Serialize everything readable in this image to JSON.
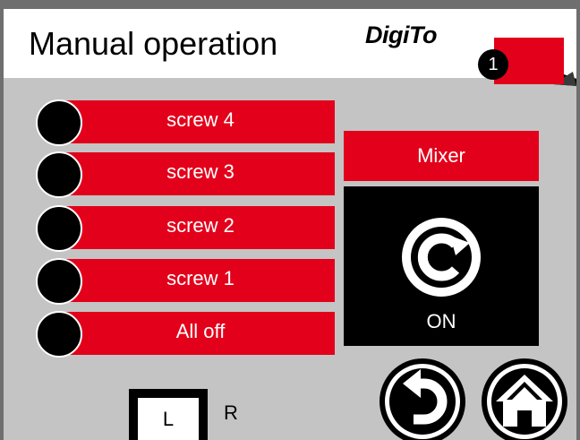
{
  "header": {
    "title": "Manual operation",
    "logo_text": "DigiTo",
    "alarm_count": "1"
  },
  "screws": [
    {
      "label": "screw 4"
    },
    {
      "label": "screw 3"
    },
    {
      "label": "screw 2"
    },
    {
      "label": "screw 1"
    },
    {
      "label": "All off"
    }
  ],
  "mixer": {
    "label": "Mixer",
    "state": "ON",
    "icon": "rotate-clockwise-icon"
  },
  "nav": {
    "back_icon": "back-arrow-icon",
    "home_icon": "home-icon"
  },
  "side_selector": {
    "left": "L",
    "right": "R",
    "selected": "L"
  },
  "colors": {
    "accent": "#e3001b",
    "background": "#c4c4c4",
    "frame": "#6f6f6f",
    "panel": "#000000"
  }
}
